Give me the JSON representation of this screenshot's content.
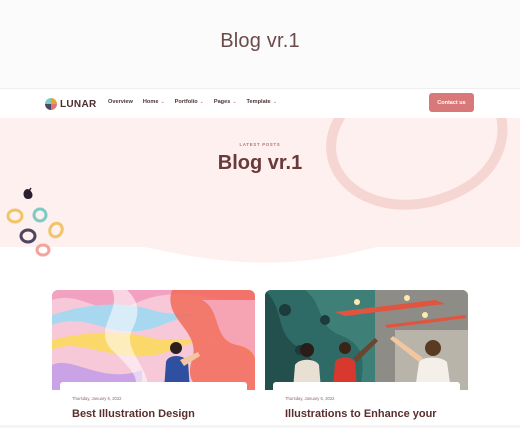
{
  "page": {
    "outer_title": "Blog vr.1"
  },
  "nav": {
    "brand": "LUNAR",
    "items": [
      {
        "label": "Overview",
        "has_dropdown": false
      },
      {
        "label": "Home",
        "has_dropdown": true
      },
      {
        "label": "Portfolio",
        "has_dropdown": true
      },
      {
        "label": "Pages",
        "has_dropdown": true
      },
      {
        "label": "Template",
        "has_dropdown": true
      }
    ],
    "cta_label": "Contact us"
  },
  "hero": {
    "eyebrow": "LATEST POSTS",
    "title": "Blog vr.1"
  },
  "posts": [
    {
      "date": "Thursday, January 6, 2022",
      "title": "Best Illustration Design"
    },
    {
      "date": "Thursday, January 6, 2022",
      "title": "Illustrations to Enhance your"
    }
  ],
  "colors": {
    "accent": "#d97878",
    "hero_bg": "#fdf0ee",
    "heading": "#6a3a3a"
  }
}
